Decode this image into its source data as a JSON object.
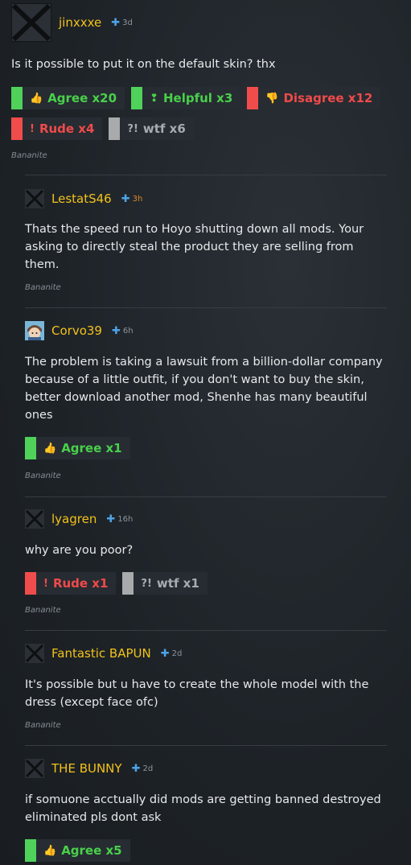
{
  "posts": [
    {
      "username": "jinxxxe",
      "time": "3d",
      "body": "Is it possible to put it on the default skin? thx",
      "signature": "Bananite",
      "ratings": [
        {
          "icon": "👍",
          "label": "Agree x20"
        },
        {
          "icon": "❢",
          "label": "Helpful x3"
        },
        {
          "icon": "👎",
          "label": "Disagree x12"
        },
        {
          "icon": "!",
          "label": "Rude x4"
        },
        {
          "icon": "?!",
          "label": "wtf x6"
        }
      ]
    },
    {
      "username": "LestatS46",
      "time": "3h",
      "body": "Thats the speed run to Hoyo shutting down all mods. Your asking to directly steal the product they are selling from them.",
      "signature": "Bananite"
    },
    {
      "username": "Corvo39",
      "time": "6h",
      "body": "The problem is taking a lawsuit from a billion-dollar company because of a little outfit, if you don't want to buy the skin, better download another mod, Shenhe has many beautiful ones",
      "signature": "Bananite",
      "ratings": [
        {
          "icon": "👍",
          "label": "Agree x1"
        }
      ]
    },
    {
      "username": "lyagren",
      "time": "16h",
      "body": "why are you poor?",
      "signature": "Bananite",
      "ratings": [
        {
          "icon": "!",
          "label": "Rude x1"
        },
        {
          "icon": "?!",
          "label": "wtf x1"
        }
      ]
    },
    {
      "username": "Fantastic BAPUN",
      "time": "2d",
      "body": "It's possible but u have to create the whole model with the dress (except face ofc)",
      "signature": "Bananite"
    },
    {
      "username": "THE BUNNY",
      "time": "2d",
      "body": "if somuone acctually did mods are getting banned destroyed eliminated pls dont ask",
      "ratings": [
        {
          "icon": "👍",
          "label": "Agree x5"
        }
      ]
    }
  ],
  "colors": {
    "username": "#f2c21a",
    "agree": "#4fd15a",
    "disagree": "#f04c4c",
    "wtf": "#a8aaac",
    "plus_icon": "#4da3e6"
  }
}
